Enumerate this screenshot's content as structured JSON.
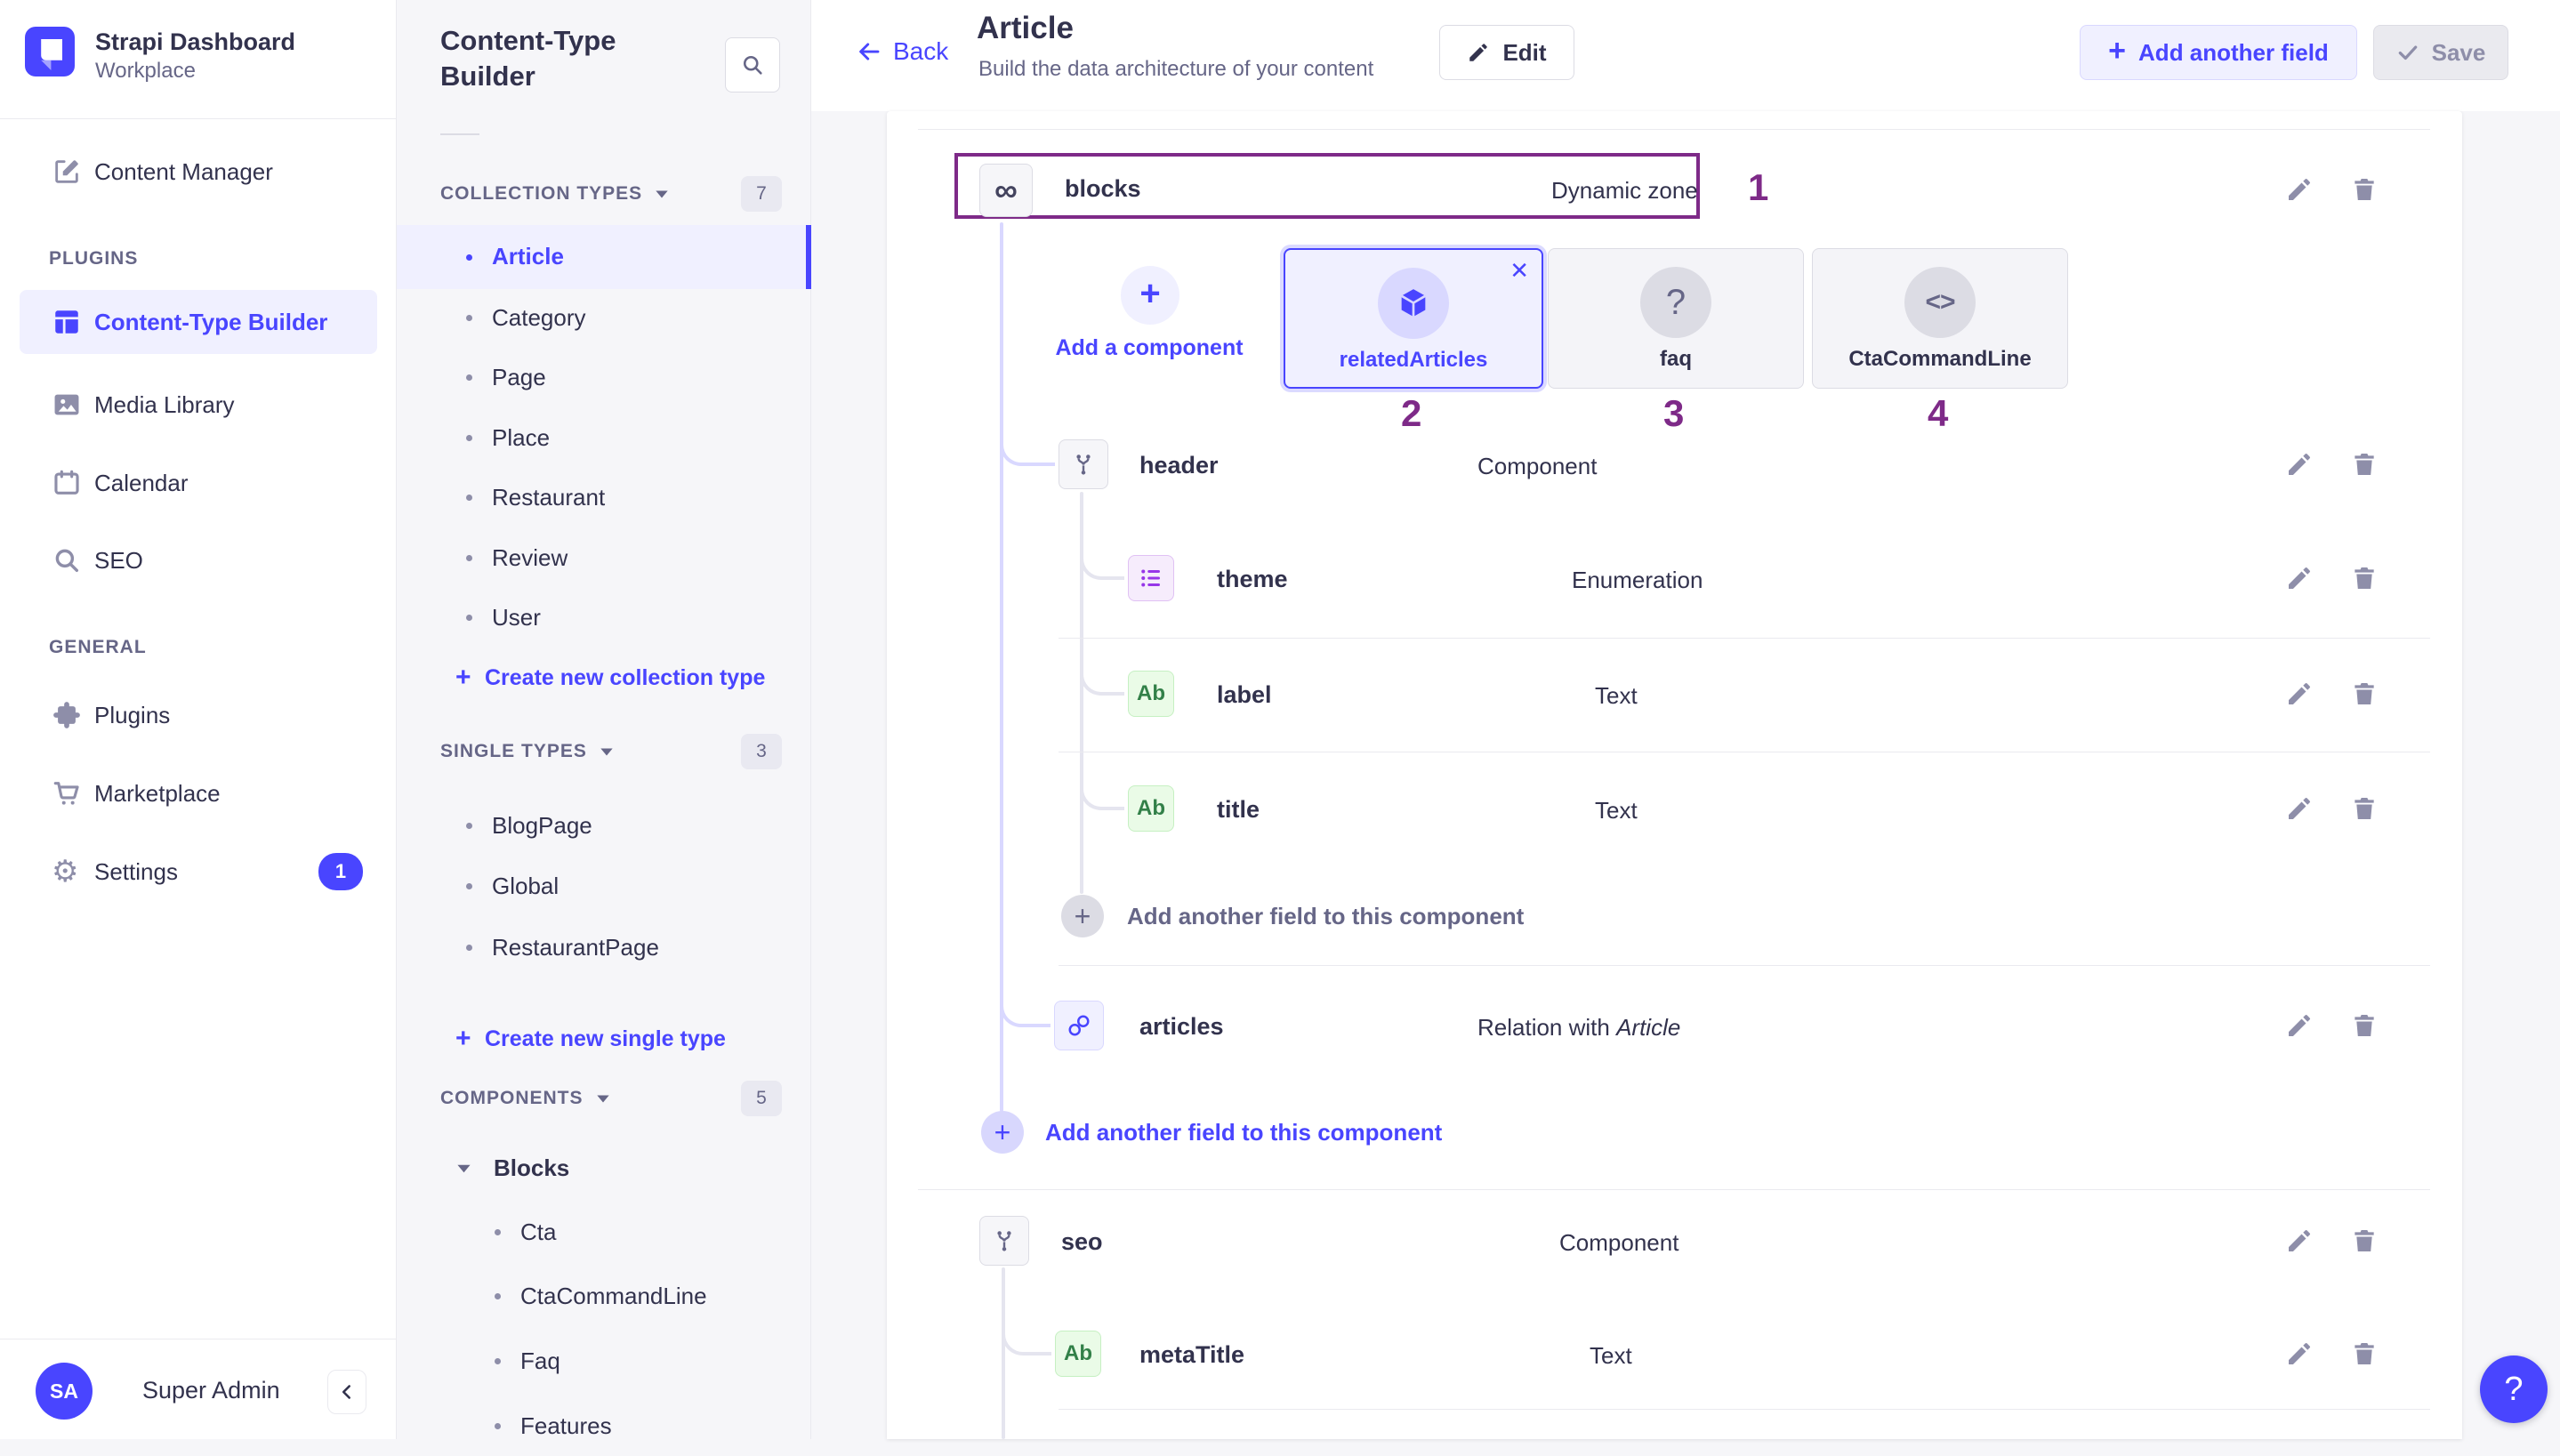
{
  "colors": {
    "accent": "#4945ff",
    "accent_bg": "#f0f0ff",
    "annotation": "#7e2a88",
    "page_bg": "#f6f6f9"
  },
  "brand": {
    "title": "Strapi Dashboard",
    "subtitle": "Workplace"
  },
  "main_nav": {
    "content_manager": "Content Manager",
    "plugins_section": "PLUGINS",
    "plugins_items": [
      {
        "label": "Content-Type Builder"
      },
      {
        "label": "Media Library"
      },
      {
        "label": "Calendar"
      },
      {
        "label": "SEO"
      }
    ],
    "general_section": "GENERAL",
    "general_items": [
      {
        "label": "Plugins"
      },
      {
        "label": "Marketplace"
      },
      {
        "label": "Settings",
        "badge": "1"
      }
    ]
  },
  "user": {
    "initials": "SA",
    "name": "Super Admin"
  },
  "builder": {
    "title": "Content-Type Builder",
    "collection": {
      "label": "COLLECTION TYPES",
      "count": "7",
      "items": [
        "Article",
        "Category",
        "Page",
        "Place",
        "Restaurant",
        "Review",
        "User"
      ],
      "selected": "Article",
      "action": "Create new collection type"
    },
    "single": {
      "label": "SINGLE TYPES",
      "count": "3",
      "items": [
        "BlogPage",
        "Global",
        "RestaurantPage"
      ],
      "action": "Create new single type"
    },
    "components": {
      "label": "COMPONENTS",
      "count": "5",
      "group": "Blocks",
      "items": [
        "Cta",
        "CtaCommandLine",
        "Faq",
        "Features"
      ]
    }
  },
  "header": {
    "back": "Back",
    "title": "Article",
    "subtitle": "Build the data architecture of your content",
    "edit": "Edit",
    "add_field": "Add another field",
    "save": "Save"
  },
  "content": {
    "rows": [
      {
        "name": "blocks",
        "type": "Dynamic zone"
      },
      {
        "name": "header",
        "type": "Component"
      },
      {
        "name": "theme",
        "type": "Enumeration"
      },
      {
        "name": "label",
        "type": "Text"
      },
      {
        "name": "title",
        "type": "Text"
      },
      {
        "name": "articles",
        "type_prefix": "Relation with ",
        "type_italic": "Article"
      },
      {
        "name": "seo",
        "type": "Component"
      },
      {
        "name": "metaTitle",
        "type": "Text"
      }
    ],
    "text_icon_glyph": "Ab",
    "infinity_glyph": "∞",
    "dynamic_zone": {
      "add": "Add a component",
      "components": [
        {
          "label": "relatedArticles",
          "selected": true
        },
        {
          "label": "faq"
        },
        {
          "label": "CtaCommandLine"
        }
      ]
    },
    "add_component_field": "Add another field to this component",
    "add_dynzone_field": "Add another field to this component"
  },
  "annotations": [
    "1",
    "2",
    "3",
    "4"
  ],
  "help": "?"
}
